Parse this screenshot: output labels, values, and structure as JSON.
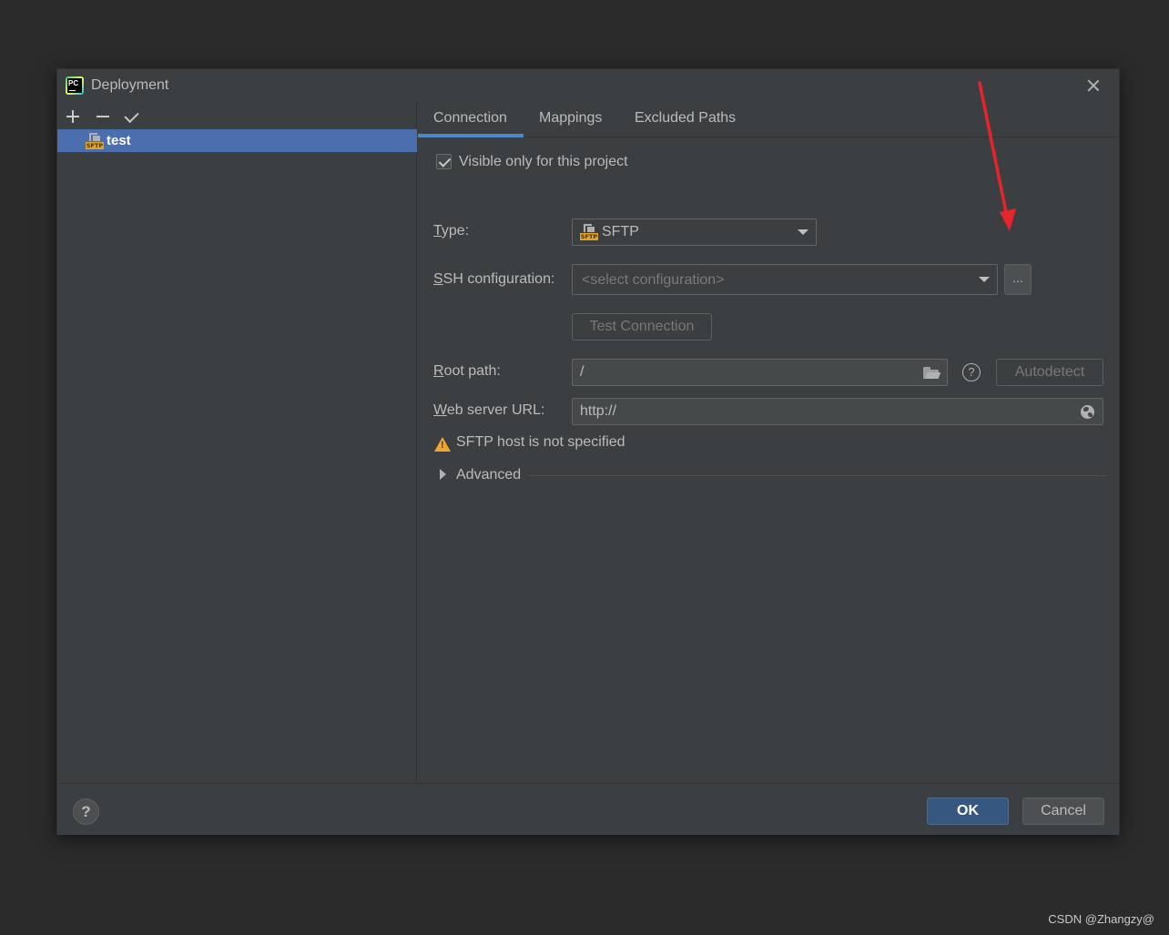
{
  "dialog": {
    "title": "Deployment",
    "app_icon_text": "PC"
  },
  "left_panel": {
    "servers": [
      {
        "name": "test",
        "type_tag": "SFTP",
        "selected": true
      }
    ]
  },
  "tabs": [
    {
      "label": "Connection",
      "active": true
    },
    {
      "label": "Mappings",
      "active": false
    },
    {
      "label": "Excluded Paths",
      "active": false
    }
  ],
  "connection": {
    "visible_only_label": "Visible only for this project",
    "visible_only_checked": true,
    "type_label_mnemonic": "T",
    "type_label_rest": "ype:",
    "type_value": "SFTP",
    "type_icon_tag": "SFTP",
    "ssh_label_mnemonic": "S",
    "ssh_label_rest": "SH configuration:",
    "ssh_placeholder": "<select configuration>",
    "ellipsis_label": "...",
    "test_connection_label": "Test Connection",
    "root_label_mnemonic": "R",
    "root_label_rest": "oot path:",
    "root_value": "/",
    "help_glyph": "?",
    "autodetect_label": "Autodetect",
    "web_url_label_mnemonic": "W",
    "web_url_label_rest": "eb server URL:",
    "web_url_value": "http://",
    "warning_text": "SFTP host is not specified",
    "advanced_label": "Advanced"
  },
  "footer": {
    "help_glyph": "?",
    "ok_label": "OK",
    "cancel_label": "Cancel"
  },
  "watermark": "CSDN @Zhangzy@",
  "colors": {
    "background": "#2b2b2b",
    "dialog": "#3c3f41",
    "selection": "#4b6eaf",
    "accent_tab": "#4a88c7",
    "ok_button": "#365880",
    "warning": "#f0a732",
    "annotation_arrow": "#e8232b"
  }
}
